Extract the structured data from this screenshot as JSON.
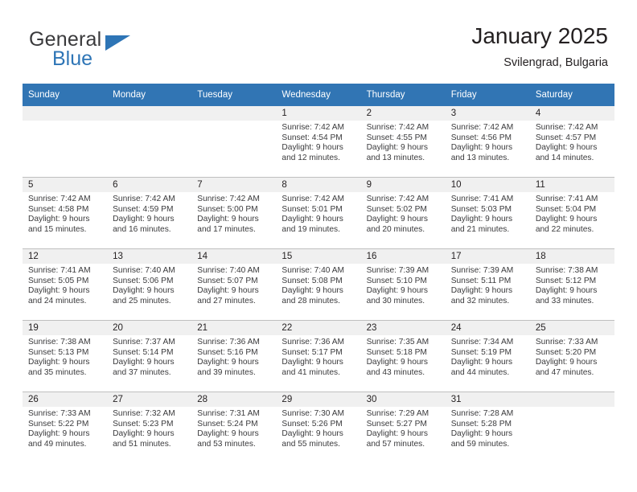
{
  "brand": {
    "name_top": "General",
    "name_bottom": "Blue",
    "accent_color": "#2e75b6"
  },
  "header": {
    "title": "January 2025",
    "subtitle": "Svilengrad, Bulgaria"
  },
  "theme": {
    "header_row_bg": "#3175b4",
    "date_strip_bg": "#f0f0f0",
    "grid_line": "#bfbfbf",
    "text": "#231f20"
  },
  "calendar": {
    "weekday_headers": [
      "Sunday",
      "Monday",
      "Tuesday",
      "Wednesday",
      "Thursday",
      "Friday",
      "Saturday"
    ],
    "weeks": [
      [
        {
          "day": "",
          "empty": true
        },
        {
          "day": "",
          "empty": true
        },
        {
          "day": "",
          "empty": true
        },
        {
          "day": "1",
          "sunrise": "Sunrise: 7:42 AM",
          "sunset": "Sunset: 4:54 PM",
          "daylight1": "Daylight: 9 hours",
          "daylight2": "and 12 minutes."
        },
        {
          "day": "2",
          "sunrise": "Sunrise: 7:42 AM",
          "sunset": "Sunset: 4:55 PM",
          "daylight1": "Daylight: 9 hours",
          "daylight2": "and 13 minutes."
        },
        {
          "day": "3",
          "sunrise": "Sunrise: 7:42 AM",
          "sunset": "Sunset: 4:56 PM",
          "daylight1": "Daylight: 9 hours",
          "daylight2": "and 13 minutes."
        },
        {
          "day": "4",
          "sunrise": "Sunrise: 7:42 AM",
          "sunset": "Sunset: 4:57 PM",
          "daylight1": "Daylight: 9 hours",
          "daylight2": "and 14 minutes."
        }
      ],
      [
        {
          "day": "5",
          "sunrise": "Sunrise: 7:42 AM",
          "sunset": "Sunset: 4:58 PM",
          "daylight1": "Daylight: 9 hours",
          "daylight2": "and 15 minutes."
        },
        {
          "day": "6",
          "sunrise": "Sunrise: 7:42 AM",
          "sunset": "Sunset: 4:59 PM",
          "daylight1": "Daylight: 9 hours",
          "daylight2": "and 16 minutes."
        },
        {
          "day": "7",
          "sunrise": "Sunrise: 7:42 AM",
          "sunset": "Sunset: 5:00 PM",
          "daylight1": "Daylight: 9 hours",
          "daylight2": "and 17 minutes."
        },
        {
          "day": "8",
          "sunrise": "Sunrise: 7:42 AM",
          "sunset": "Sunset: 5:01 PM",
          "daylight1": "Daylight: 9 hours",
          "daylight2": "and 19 minutes."
        },
        {
          "day": "9",
          "sunrise": "Sunrise: 7:42 AM",
          "sunset": "Sunset: 5:02 PM",
          "daylight1": "Daylight: 9 hours",
          "daylight2": "and 20 minutes."
        },
        {
          "day": "10",
          "sunrise": "Sunrise: 7:41 AM",
          "sunset": "Sunset: 5:03 PM",
          "daylight1": "Daylight: 9 hours",
          "daylight2": "and 21 minutes."
        },
        {
          "day": "11",
          "sunrise": "Sunrise: 7:41 AM",
          "sunset": "Sunset: 5:04 PM",
          "daylight1": "Daylight: 9 hours",
          "daylight2": "and 22 minutes."
        }
      ],
      [
        {
          "day": "12",
          "sunrise": "Sunrise: 7:41 AM",
          "sunset": "Sunset: 5:05 PM",
          "daylight1": "Daylight: 9 hours",
          "daylight2": "and 24 minutes."
        },
        {
          "day": "13",
          "sunrise": "Sunrise: 7:40 AM",
          "sunset": "Sunset: 5:06 PM",
          "daylight1": "Daylight: 9 hours",
          "daylight2": "and 25 minutes."
        },
        {
          "day": "14",
          "sunrise": "Sunrise: 7:40 AM",
          "sunset": "Sunset: 5:07 PM",
          "daylight1": "Daylight: 9 hours",
          "daylight2": "and 27 minutes."
        },
        {
          "day": "15",
          "sunrise": "Sunrise: 7:40 AM",
          "sunset": "Sunset: 5:08 PM",
          "daylight1": "Daylight: 9 hours",
          "daylight2": "and 28 minutes."
        },
        {
          "day": "16",
          "sunrise": "Sunrise: 7:39 AM",
          "sunset": "Sunset: 5:10 PM",
          "daylight1": "Daylight: 9 hours",
          "daylight2": "and 30 minutes."
        },
        {
          "day": "17",
          "sunrise": "Sunrise: 7:39 AM",
          "sunset": "Sunset: 5:11 PM",
          "daylight1": "Daylight: 9 hours",
          "daylight2": "and 32 minutes."
        },
        {
          "day": "18",
          "sunrise": "Sunrise: 7:38 AM",
          "sunset": "Sunset: 5:12 PM",
          "daylight1": "Daylight: 9 hours",
          "daylight2": "and 33 minutes."
        }
      ],
      [
        {
          "day": "19",
          "sunrise": "Sunrise: 7:38 AM",
          "sunset": "Sunset: 5:13 PM",
          "daylight1": "Daylight: 9 hours",
          "daylight2": "and 35 minutes."
        },
        {
          "day": "20",
          "sunrise": "Sunrise: 7:37 AM",
          "sunset": "Sunset: 5:14 PM",
          "daylight1": "Daylight: 9 hours",
          "daylight2": "and 37 minutes."
        },
        {
          "day": "21",
          "sunrise": "Sunrise: 7:36 AM",
          "sunset": "Sunset: 5:16 PM",
          "daylight1": "Daylight: 9 hours",
          "daylight2": "and 39 minutes."
        },
        {
          "day": "22",
          "sunrise": "Sunrise: 7:36 AM",
          "sunset": "Sunset: 5:17 PM",
          "daylight1": "Daylight: 9 hours",
          "daylight2": "and 41 minutes."
        },
        {
          "day": "23",
          "sunrise": "Sunrise: 7:35 AM",
          "sunset": "Sunset: 5:18 PM",
          "daylight1": "Daylight: 9 hours",
          "daylight2": "and 43 minutes."
        },
        {
          "day": "24",
          "sunrise": "Sunrise: 7:34 AM",
          "sunset": "Sunset: 5:19 PM",
          "daylight1": "Daylight: 9 hours",
          "daylight2": "and 44 minutes."
        },
        {
          "day": "25",
          "sunrise": "Sunrise: 7:33 AM",
          "sunset": "Sunset: 5:20 PM",
          "daylight1": "Daylight: 9 hours",
          "daylight2": "and 47 minutes."
        }
      ],
      [
        {
          "day": "26",
          "sunrise": "Sunrise: 7:33 AM",
          "sunset": "Sunset: 5:22 PM",
          "daylight1": "Daylight: 9 hours",
          "daylight2": "and 49 minutes."
        },
        {
          "day": "27",
          "sunrise": "Sunrise: 7:32 AM",
          "sunset": "Sunset: 5:23 PM",
          "daylight1": "Daylight: 9 hours",
          "daylight2": "and 51 minutes."
        },
        {
          "day": "28",
          "sunrise": "Sunrise: 7:31 AM",
          "sunset": "Sunset: 5:24 PM",
          "daylight1": "Daylight: 9 hours",
          "daylight2": "and 53 minutes."
        },
        {
          "day": "29",
          "sunrise": "Sunrise: 7:30 AM",
          "sunset": "Sunset: 5:26 PM",
          "daylight1": "Daylight: 9 hours",
          "daylight2": "and 55 minutes."
        },
        {
          "day": "30",
          "sunrise": "Sunrise: 7:29 AM",
          "sunset": "Sunset: 5:27 PM",
          "daylight1": "Daylight: 9 hours",
          "daylight2": "and 57 minutes."
        },
        {
          "day": "31",
          "sunrise": "Sunrise: 7:28 AM",
          "sunset": "Sunset: 5:28 PM",
          "daylight1": "Daylight: 9 hours",
          "daylight2": "and 59 minutes."
        },
        {
          "day": "",
          "empty": true
        }
      ]
    ]
  }
}
